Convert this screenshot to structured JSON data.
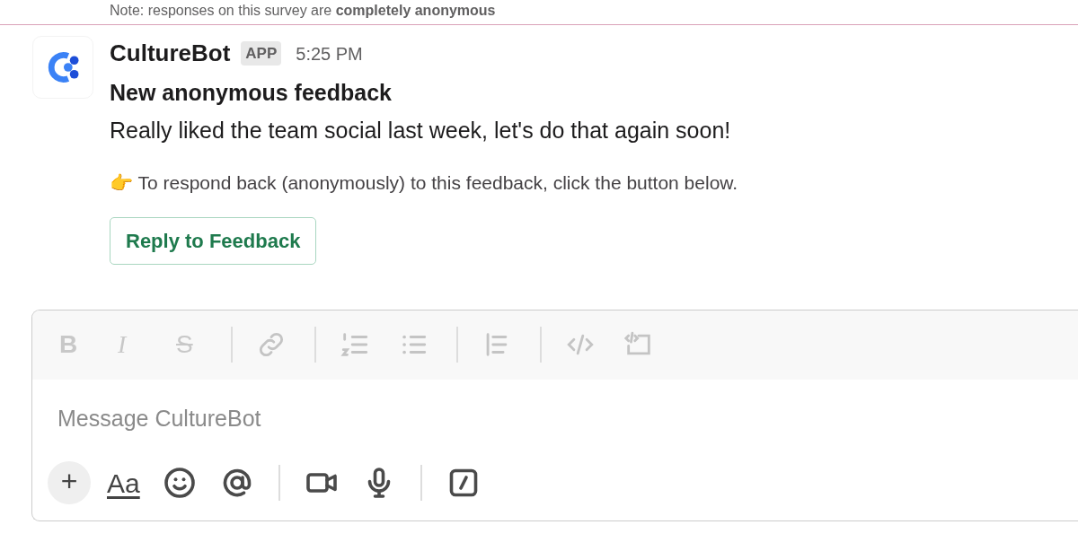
{
  "previous_note": "Note: responses on this survey are **completely anonymous**",
  "message": {
    "sender": "CultureBot",
    "badge": "APP",
    "time": "5:25 PM",
    "title": "New anonymous feedback",
    "body": "Really liked the team social last week, let's do that again soon!",
    "hint": "👉 To respond back (anonymously) to this feedback, click the button below.",
    "button": "Reply to Feedback"
  },
  "composer": {
    "format_glyphs": [
      "B",
      "I",
      "S"
    ],
    "placeholder": "Message CultureBot",
    "plus": "+",
    "text_format": "Aa"
  }
}
